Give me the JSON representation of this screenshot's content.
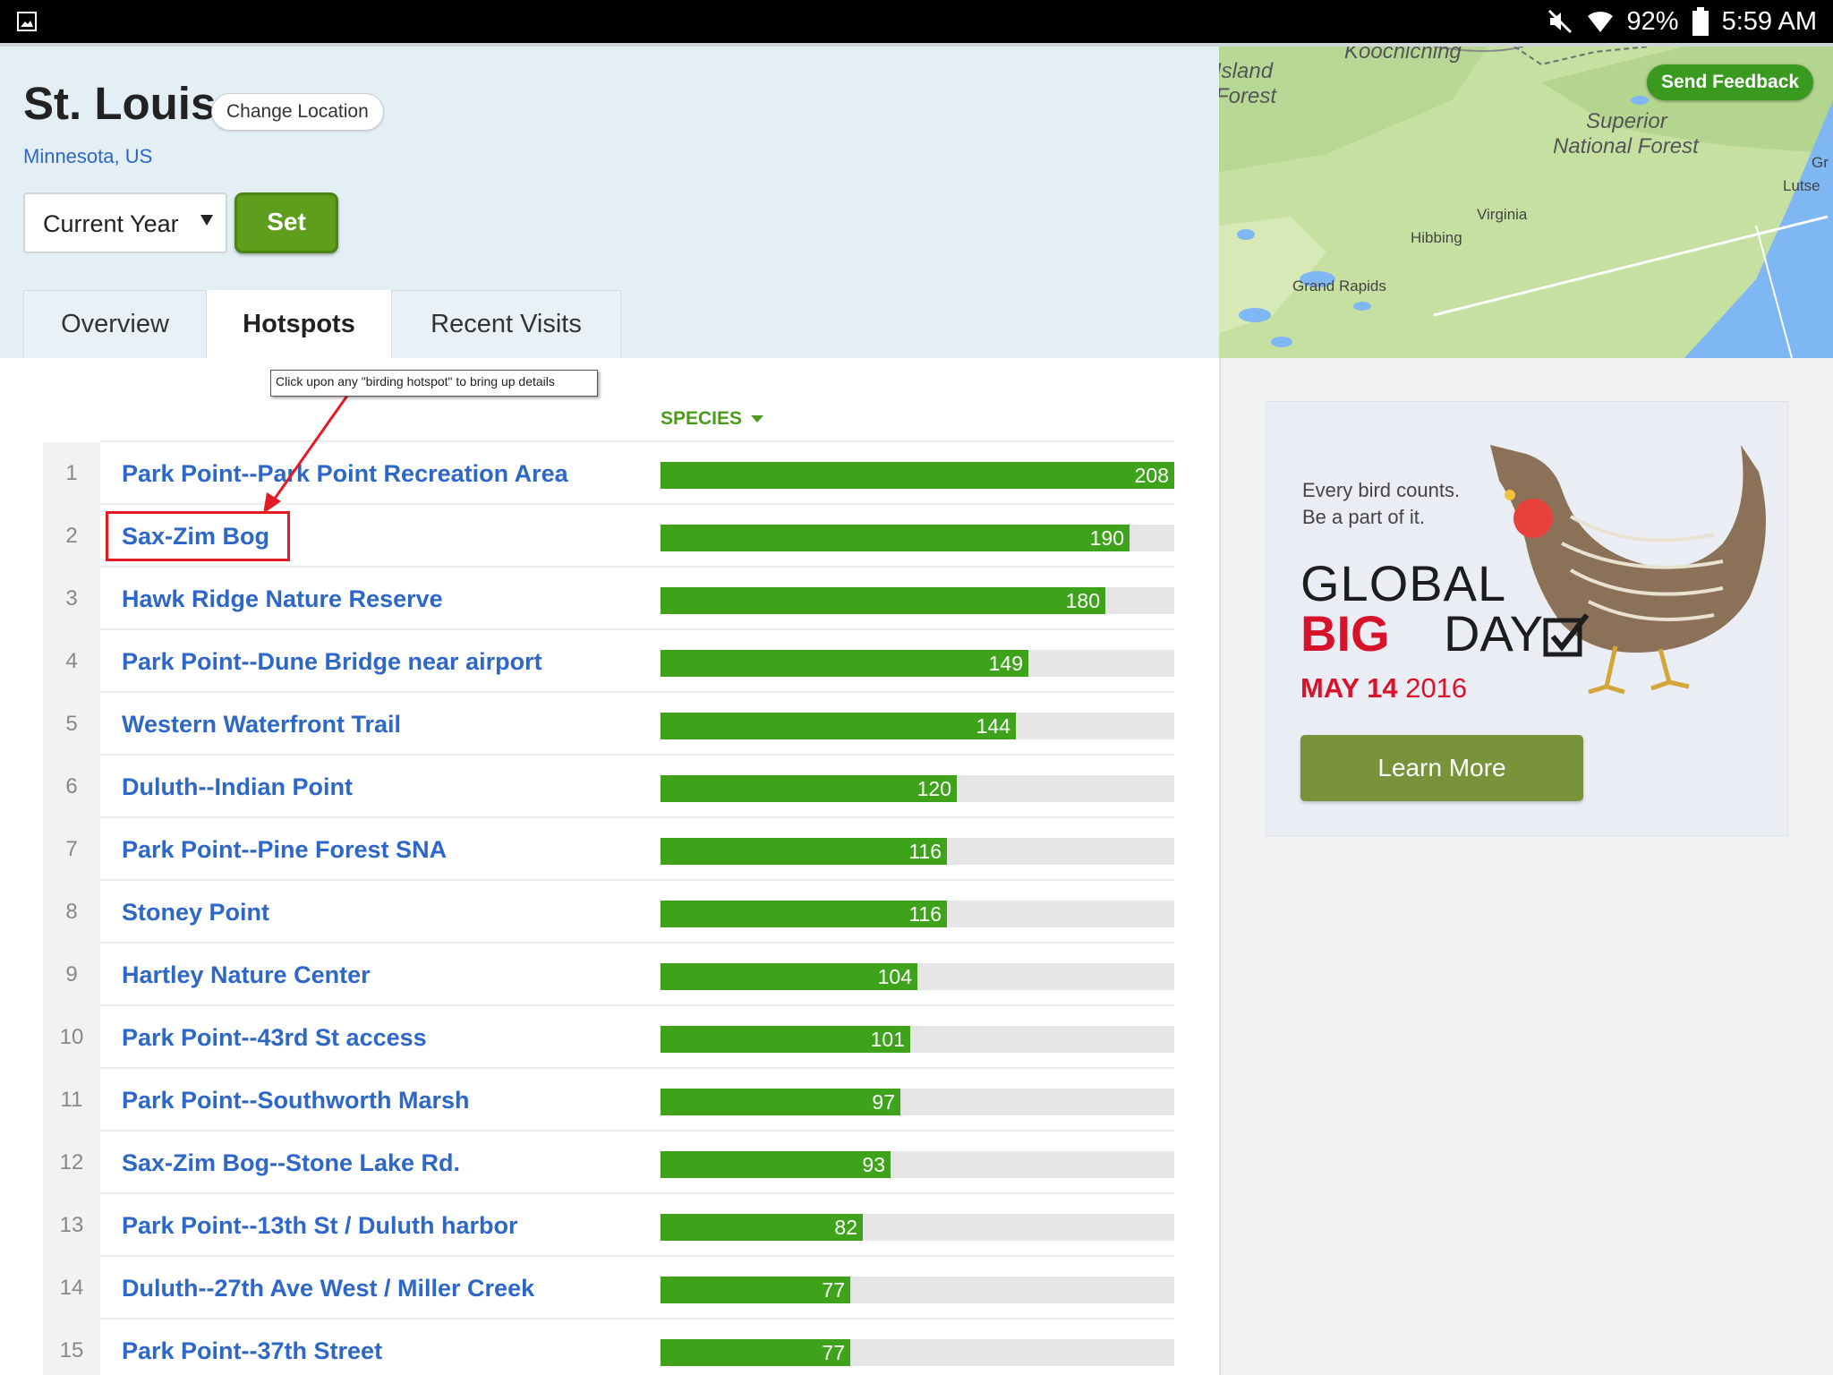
{
  "status_bar": {
    "battery": "92%",
    "time": "5:59 AM"
  },
  "location": {
    "title": "St. Louis",
    "change_label": "Change Location",
    "subtitle": "Minnesota, US"
  },
  "controls": {
    "year_value": "Current Year",
    "set_label": "Set"
  },
  "tabs": [
    {
      "label": "Overview",
      "active": false
    },
    {
      "label": "Hotspots",
      "active": true
    },
    {
      "label": "Recent Visits",
      "active": false
    }
  ],
  "map": {
    "labels": {
      "koochiching": "Koochiching",
      "island_forest_1": "Island",
      "island_forest_2": "Forest",
      "superior_1": "Superior",
      "superior_2": "National Forest",
      "virginia": "Virginia",
      "hibbing": "Hibbing",
      "grand_rapids": "Grand Rapids",
      "gr": "Gr",
      "lutsen": "Lutse"
    },
    "feedback_label": "Send Feedback"
  },
  "annotation": {
    "callout_text": "Click upon any \"birding hotspot\" to bring up details"
  },
  "table": {
    "species_header": "SPECIES",
    "max_value": 208,
    "rows": [
      {
        "rank": "1",
        "name": "Park Point--Park Point Recreation Area",
        "species": 208
      },
      {
        "rank": "2",
        "name": "Sax-Zim Bog",
        "species": 190
      },
      {
        "rank": "3",
        "name": "Hawk Ridge Nature Reserve",
        "species": 180
      },
      {
        "rank": "4",
        "name": "Park Point--Dune Bridge near airport",
        "species": 149
      },
      {
        "rank": "5",
        "name": "Western Waterfront Trail",
        "species": 144
      },
      {
        "rank": "6",
        "name": "Duluth--Indian Point",
        "species": 120
      },
      {
        "rank": "7",
        "name": "Park Point--Pine Forest SNA",
        "species": 116
      },
      {
        "rank": "8",
        "name": "Stoney Point",
        "species": 116
      },
      {
        "rank": "9",
        "name": "Hartley Nature Center",
        "species": 104
      },
      {
        "rank": "10",
        "name": "Park Point--43rd St access",
        "species": 101
      },
      {
        "rank": "11",
        "name": "Park Point--Southworth Marsh",
        "species": 97
      },
      {
        "rank": "12",
        "name": "Sax-Zim Bog--Stone Lake Rd.",
        "species": 93
      },
      {
        "rank": "13",
        "name": "Park Point--13th St / Duluth harbor",
        "species": 82
      },
      {
        "rank": "14",
        "name": "Duluth--27th Ave West / Miller Creek",
        "species": 77
      },
      {
        "rank": "15",
        "name": "Park Point--37th Street",
        "species": 77
      }
    ]
  },
  "ad": {
    "tagline_1": "Every bird counts.",
    "tagline_2": "Be a part of it.",
    "global": "GLOBAL",
    "big": "BIG",
    "day": "DAY",
    "date_strong": "MAY 14",
    "date_year": "2016",
    "learn_more": "Learn More"
  },
  "colors": {
    "bar_fill": "#3ea31b",
    "bar_track": "#e6e6e6",
    "link_blue": "#2d67c7",
    "set_green": "#5e9e1c",
    "annotation_red": "#e21c22"
  }
}
